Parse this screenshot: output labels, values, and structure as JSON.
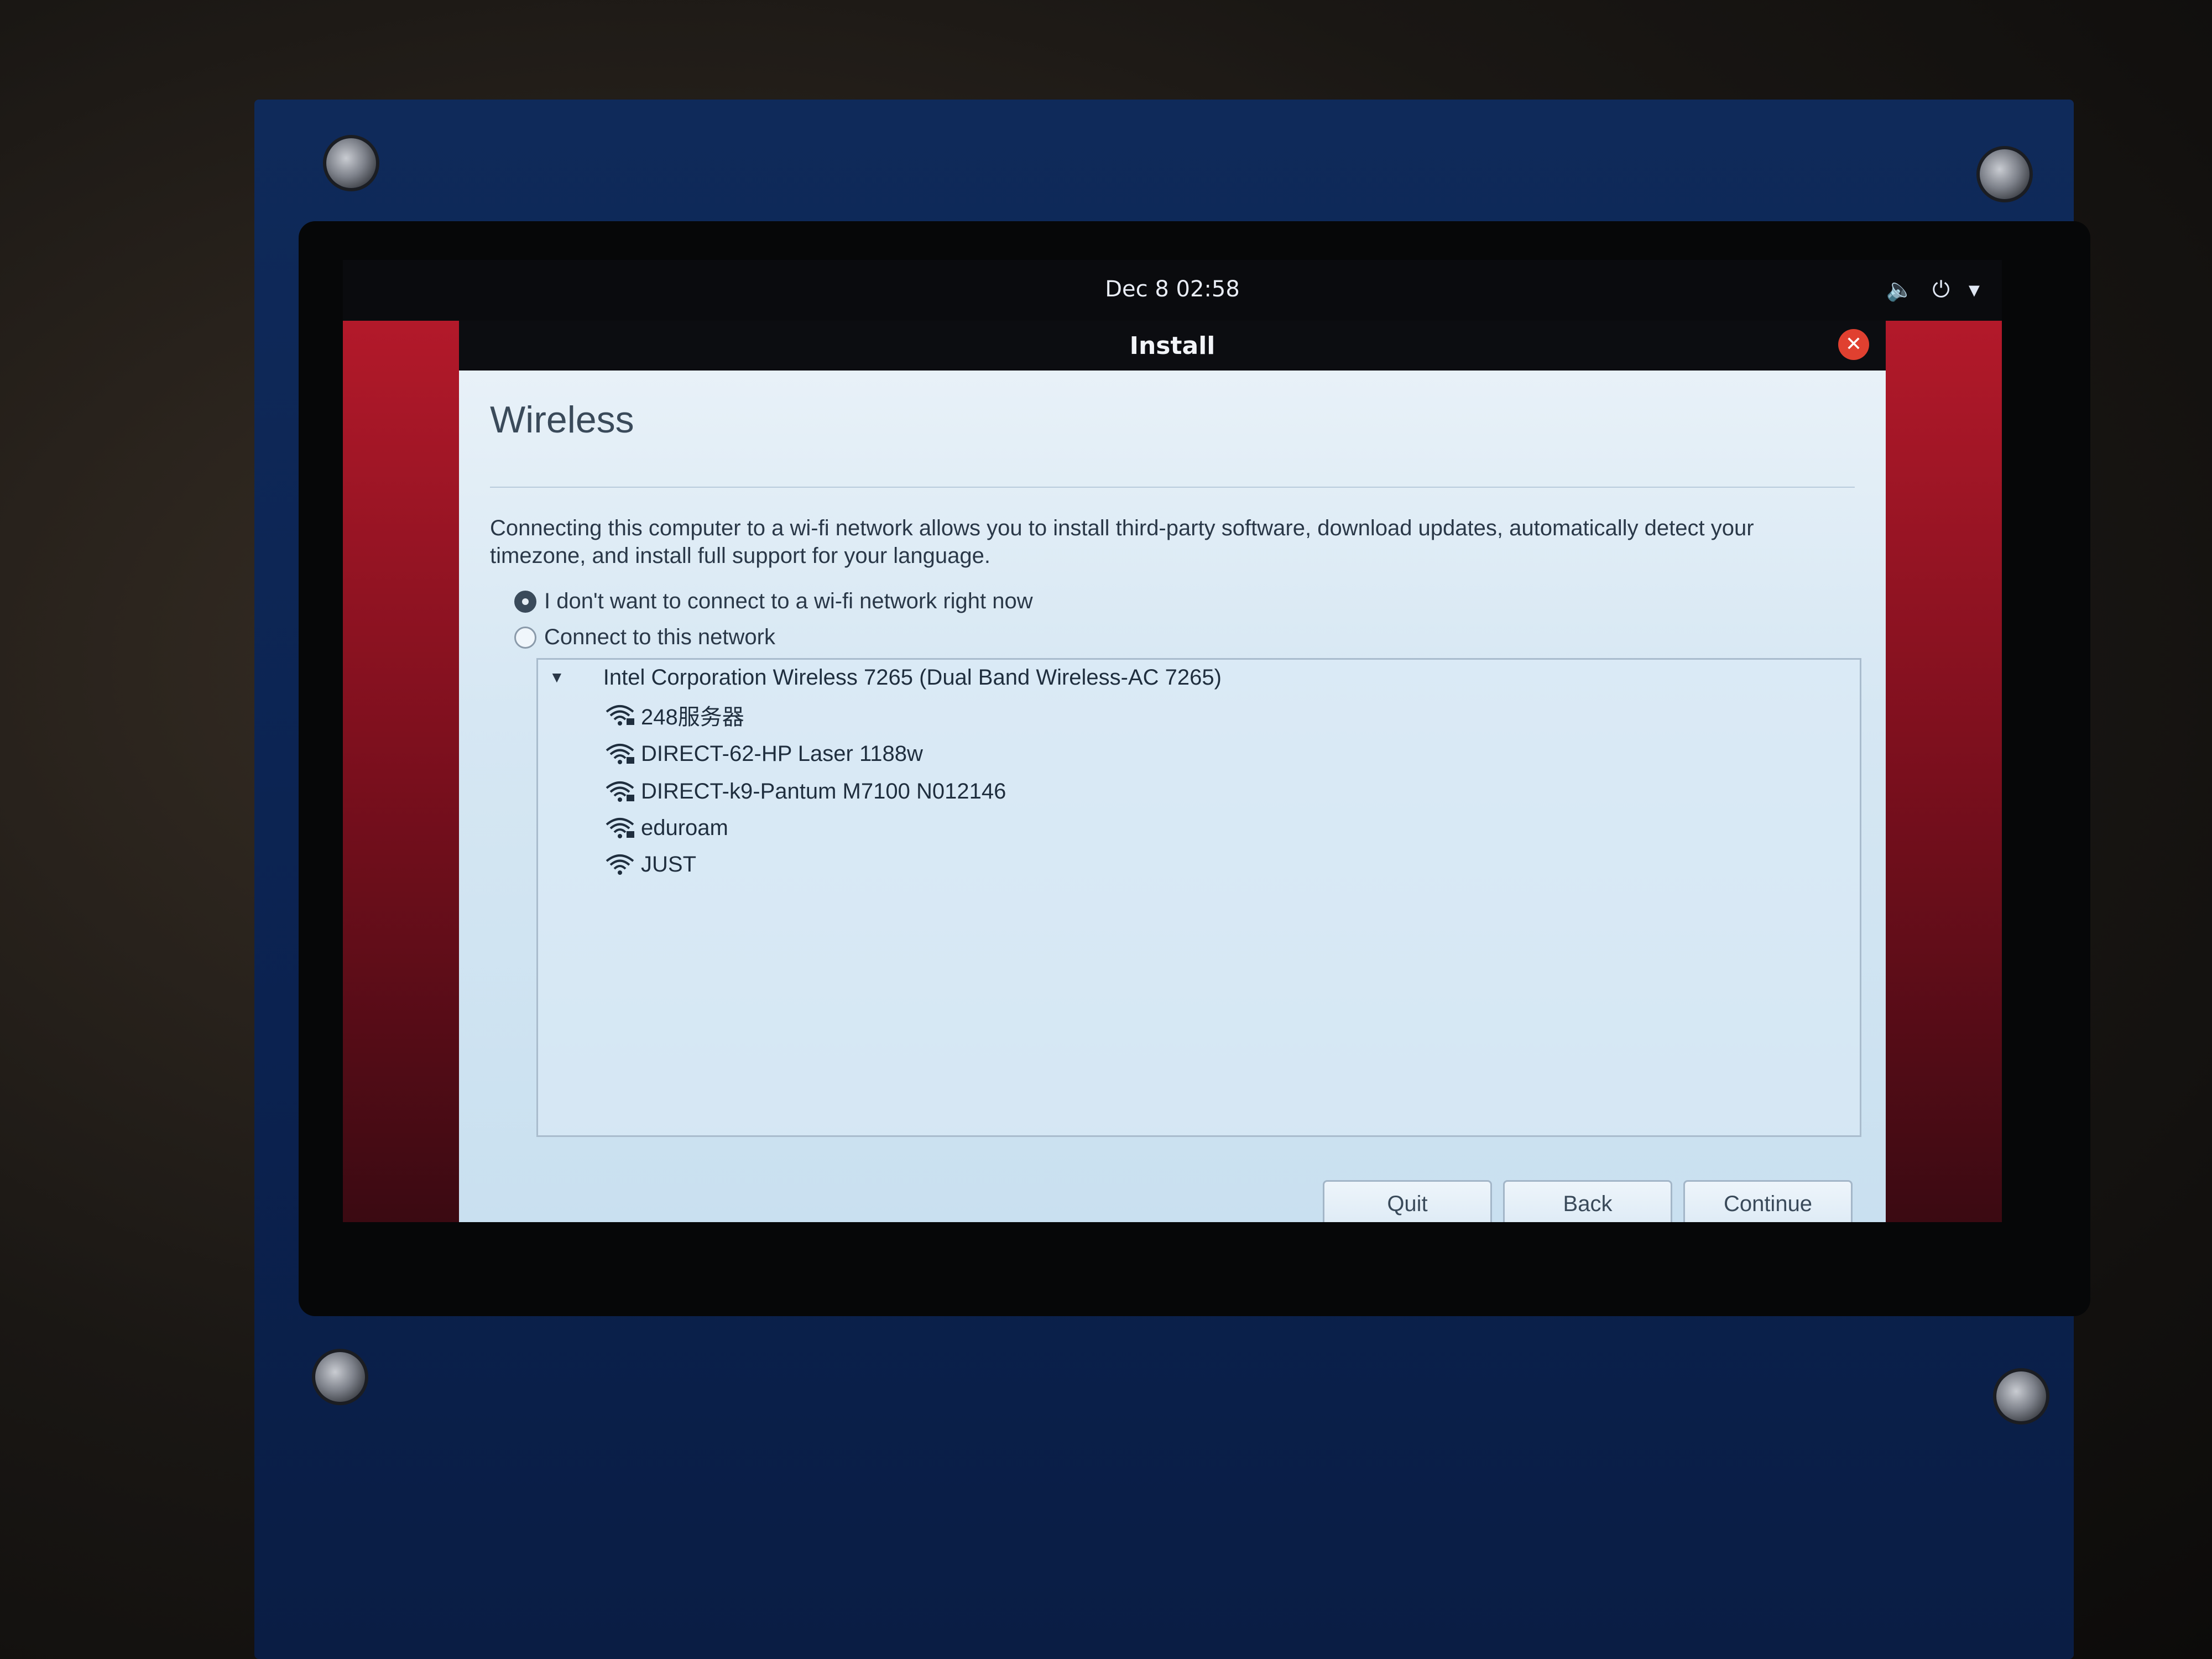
{
  "topbar": {
    "clock": "Dec 8  02:58"
  },
  "window": {
    "title": "Install",
    "close_glyph": "✕"
  },
  "page": {
    "heading": "Wireless",
    "description": "Connecting this computer to a wi-fi network allows you to install third-party software, download updates, automatically detect your timezone, and install full support for your language.",
    "options": [
      {
        "label": "I don't want to connect to a wi-fi network right now",
        "selected": true
      },
      {
        "label": "Connect to this network",
        "selected": false
      }
    ]
  },
  "networks": {
    "adapter": "Intel Corporation Wireless 7265 (Dual Band Wireless-AC 7265)",
    "items": [
      {
        "ssid": "248服务器",
        "secured": true
      },
      {
        "ssid": "DIRECT-62-HP Laser 1188w",
        "secured": true
      },
      {
        "ssid": "DIRECT-k9-Pantum M7100 N012146",
        "secured": true
      },
      {
        "ssid": "eduroam",
        "secured": true
      },
      {
        "ssid": "JUST",
        "secured": false
      }
    ]
  },
  "buttons": {
    "quit": "Quit",
    "back": "Back",
    "continue": "Continue"
  },
  "icons": {
    "volume": "volume-icon",
    "power": "power-icon",
    "menu": "chevron-down-icon",
    "wifi": "wifi-signal-icon",
    "lock": "lock-icon",
    "caret": "caret-down-icon"
  }
}
